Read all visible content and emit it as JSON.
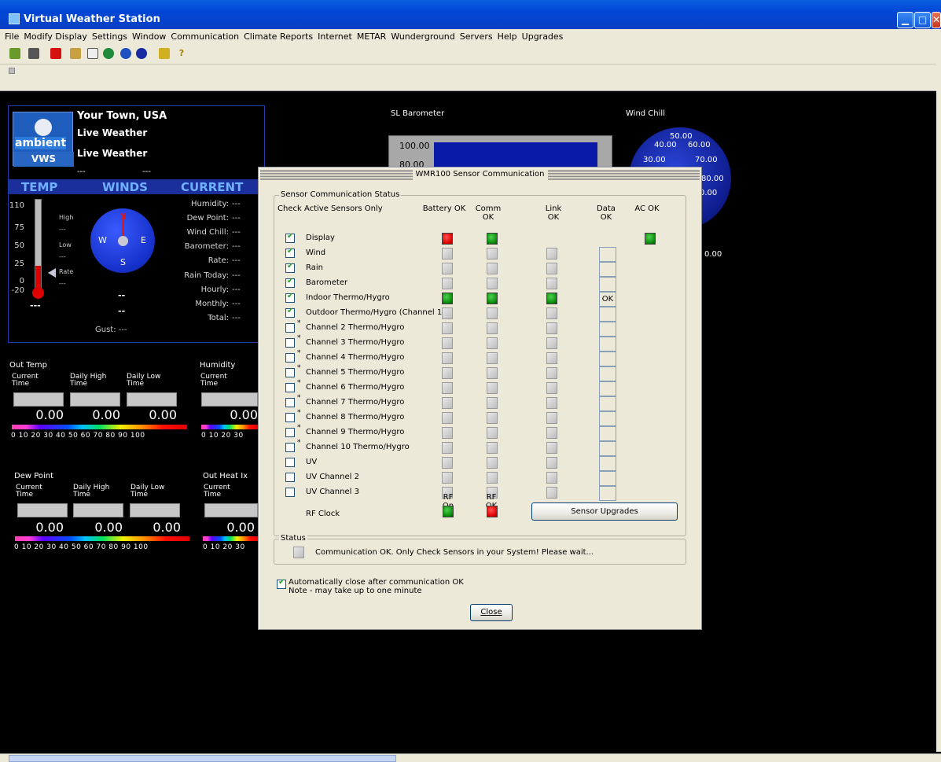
{
  "app": {
    "title": "Virtual Weather Station"
  },
  "menu": [
    "File",
    "Modify Display",
    "Settings",
    "Window",
    "Communication",
    "Climate Reports",
    "Internet",
    "METAR",
    "Wunderground",
    "Servers",
    "Help",
    "Upgrades"
  ],
  "panel": {
    "town": "Your Town, USA",
    "live1": "Live Weather",
    "live2": "Live Weather",
    "logo_brand": "ambient",
    "logo_vws": "VWS",
    "dashes": [
      "---",
      "---"
    ],
    "headers": {
      "temp": "TEMP",
      "winds": "WINDS",
      "current": "CURRENT"
    },
    "temp_scale": [
      "110",
      "75",
      "50",
      "25",
      "0",
      "-20"
    ],
    "temp_labels": {
      "high": "High",
      "high_val": "---",
      "low": "Low",
      "low_val": "---",
      "rate": "Rate",
      "rate_val": "---",
      "reading": "---"
    },
    "compass": {
      "n": "N",
      "e": "E",
      "w": "W",
      "s": "S"
    },
    "wind_dashes": [
      "--",
      "--"
    ],
    "gust": "Gust: ---",
    "current": [
      {
        "label": "Humidity:",
        "value": "---"
      },
      {
        "label": "Dew Point:",
        "value": "---"
      },
      {
        "label": "Wind Chill:",
        "value": "---"
      },
      {
        "label": "Barometer:",
        "value": "---"
      },
      {
        "label": "Rate:",
        "value": "---"
      },
      {
        "label": "Rain Today:",
        "value": "---"
      },
      {
        "label": "Hourly:",
        "value": "---"
      },
      {
        "label": "Monthly:",
        "value": "---"
      },
      {
        "label": "Total:",
        "value": "---"
      }
    ]
  },
  "gauges": {
    "out_temp": {
      "title": "Out Temp",
      "c1": "Current",
      "c1b": "Time",
      "c2": "Daily High",
      "c2b": "Time",
      "c3": "Daily Low",
      "c3b": "Time",
      "v1": "0.00",
      "v2": "0.00",
      "v3": "0.00"
    },
    "humidity": {
      "title": "Humidity",
      "c1": "Current",
      "c1b": "Time",
      "v1": "0.00"
    },
    "dew_point": {
      "title": "Dew Point",
      "c1": "Current",
      "c1b": "Time",
      "c2": "Daily High",
      "c2b": "Time",
      "c3": "Daily Low",
      "c3b": "Time",
      "v1": "0.00",
      "v2": "0.00",
      "v3": "0.00"
    },
    "heat_ix": {
      "title": "Out Heat Ix",
      "c1": "Current",
      "c1b": "Time",
      "v1": "0.00"
    },
    "scale_full": "0  10  20  30  40  50  60  70  80  90 100",
    "scale_part": "0  10  20  30"
  },
  "barometer": {
    "label": "SL Barometer",
    "t1": "100.00",
    "t2": "80.00"
  },
  "wind_chill": {
    "label": "Wind Chill",
    "ticks": [
      "50.00",
      "40.00",
      "60.00",
      "30.00",
      "70.00",
      "80.00",
      "0.00",
      "0.00"
    ]
  },
  "dialog": {
    "title": "WMR100 Sensor Communication",
    "group": "Sensor Communication Status",
    "check_active": "Check Active Sensors Only",
    "cols": {
      "battery": "Battery OK",
      "comm": "Comm OK",
      "link": "Link OK",
      "data": "Data OK",
      "ac": "AC OK"
    },
    "rows": [
      {
        "label": "Display",
        "checked": true,
        "star": false,
        "battery": "red",
        "comm": "green",
        "link": "",
        "data": "",
        "ac": "green"
      },
      {
        "label": "Wind",
        "checked": true,
        "star": false,
        "battery": "gray",
        "comm": "gray",
        "link": "gray",
        "data": "box",
        "ac": ""
      },
      {
        "label": "Rain",
        "checked": true,
        "star": false,
        "battery": "gray",
        "comm": "gray",
        "link": "gray",
        "data": "box",
        "ac": ""
      },
      {
        "label": "Barometer",
        "checked": true,
        "star": false,
        "battery": "gray",
        "comm": "gray",
        "link": "gray",
        "data": "box",
        "ac": ""
      },
      {
        "label": "Indoor Thermo/Hygro",
        "checked": true,
        "star": false,
        "battery": "green",
        "comm": "green",
        "link": "green",
        "data": "OK",
        "ac": ""
      },
      {
        "label": "Outdoor Thermo/Hygro (Channel 1)",
        "checked": true,
        "star": false,
        "battery": "gray",
        "comm": "gray",
        "link": "gray",
        "data": "box",
        "ac": ""
      },
      {
        "label": "Channel 2 Thermo/Hygro",
        "checked": false,
        "star": true,
        "battery": "gray",
        "comm": "gray",
        "link": "gray",
        "data": "box",
        "ac": ""
      },
      {
        "label": "Channel 3 Thermo/Hygro",
        "checked": false,
        "star": true,
        "battery": "gray",
        "comm": "gray",
        "link": "gray",
        "data": "box",
        "ac": ""
      },
      {
        "label": "Channel 4 Thermo/Hygro",
        "checked": false,
        "star": true,
        "battery": "gray",
        "comm": "gray",
        "link": "gray",
        "data": "box",
        "ac": ""
      },
      {
        "label": "Channel 5 Thermo/Hygro",
        "checked": false,
        "star": true,
        "battery": "gray",
        "comm": "gray",
        "link": "gray",
        "data": "box",
        "ac": ""
      },
      {
        "label": "Channel 6 Thermo/Hygro",
        "checked": false,
        "star": true,
        "battery": "gray",
        "comm": "gray",
        "link": "gray",
        "data": "box",
        "ac": ""
      },
      {
        "label": "Channel 7 Thermo/Hygro",
        "checked": false,
        "star": true,
        "battery": "gray",
        "comm": "gray",
        "link": "gray",
        "data": "box",
        "ac": ""
      },
      {
        "label": "Channel 8 Thermo/Hygro",
        "checked": false,
        "star": true,
        "battery": "gray",
        "comm": "gray",
        "link": "gray",
        "data": "box",
        "ac": ""
      },
      {
        "label": "Channel 9 Thermo/Hygro",
        "checked": false,
        "star": true,
        "battery": "gray",
        "comm": "gray",
        "link": "gray",
        "data": "box",
        "ac": ""
      },
      {
        "label": "Channel 10 Thermo/Hygro",
        "checked": false,
        "star": true,
        "battery": "gray",
        "comm": "gray",
        "link": "gray",
        "data": "box",
        "ac": ""
      },
      {
        "label": "UV",
        "checked": false,
        "star": false,
        "battery": "gray",
        "comm": "gray",
        "link": "gray",
        "data": "box",
        "ac": ""
      },
      {
        "label": "UV Channel 2",
        "checked": false,
        "star": false,
        "battery": "gray",
        "comm": "gray",
        "link": "gray",
        "data": "box",
        "ac": ""
      },
      {
        "label": "UV Channel 3",
        "checked": false,
        "star": false,
        "battery": "gray",
        "comm": "gray",
        "link": "gray",
        "data": "box",
        "ac": ""
      }
    ],
    "rf_on": "RF On",
    "rf_ok": "RF OK",
    "rf_clock": "RF Clock",
    "sensor_upgrades": "Sensor Upgrades",
    "status_group": "Status",
    "status_text": "Communication OK. Only Check Sensors in your System! Please wait...",
    "auto_close": "Automatically close after communication OK",
    "note": "Note - may take up to one minute",
    "close": "Close"
  }
}
